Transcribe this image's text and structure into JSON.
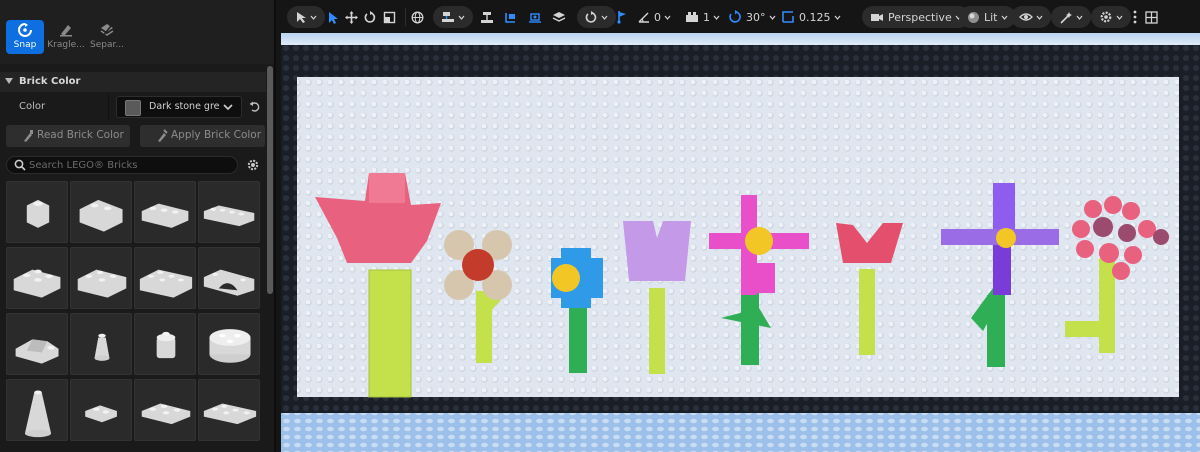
{
  "tools": [
    {
      "label": "Snap",
      "icon": "snap-icon",
      "active": true
    },
    {
      "label": "Kragle...",
      "icon": "kragle-icon",
      "active": false
    },
    {
      "label": "Separ...",
      "icon": "separate-icon",
      "active": false
    }
  ],
  "brick_color": {
    "section_title": "Brick Color",
    "color_label": "Color",
    "selected_color": "Dark stone grey",
    "swatch": "#5a5a5a",
    "read_button": "Read Brick Color",
    "apply_button": "Apply Brick Color"
  },
  "search": {
    "placeholder": "Search LEGO® Bricks"
  },
  "bricks": [
    {
      "name": "brick-1x1"
    },
    {
      "name": "brick-1x2"
    },
    {
      "name": "brick-1x3"
    },
    {
      "name": "brick-1x4"
    },
    {
      "name": "brick-2x2"
    },
    {
      "name": "brick-2x3"
    },
    {
      "name": "brick-2x4"
    },
    {
      "name": "arch-1x4"
    },
    {
      "name": "slope-brick"
    },
    {
      "name": "cone-1x1"
    },
    {
      "name": "round-1x1"
    },
    {
      "name": "round-2x2"
    },
    {
      "name": "cone-tall"
    },
    {
      "name": "plate-1x2"
    },
    {
      "name": "plate-2x3"
    },
    {
      "name": "plate-2x4"
    }
  ],
  "viewport_toolbar": {
    "angle_snap_value": "0",
    "scale_value": "1",
    "rotation_snap": "30°",
    "grid_snap": "0.125",
    "view_mode": "Perspective",
    "lighting_mode": "Lit"
  },
  "colors": {
    "accent": "#0d6fe0",
    "panel": "#1a1a1a",
    "baseplate": "#dde4ee",
    "frame": "#1c2028",
    "pink": "#e8617f",
    "lime": "#c4e04a",
    "green": "#2fae55",
    "lavender": "#c49ae8",
    "magenta": "#e84fc8",
    "purple": "#7a3cd8",
    "blue": "#2f9ae8",
    "yellow": "#f2c624",
    "red": "#c23b2b",
    "tan": "#d7c6ae",
    "mauve": "#9b4b6e"
  }
}
